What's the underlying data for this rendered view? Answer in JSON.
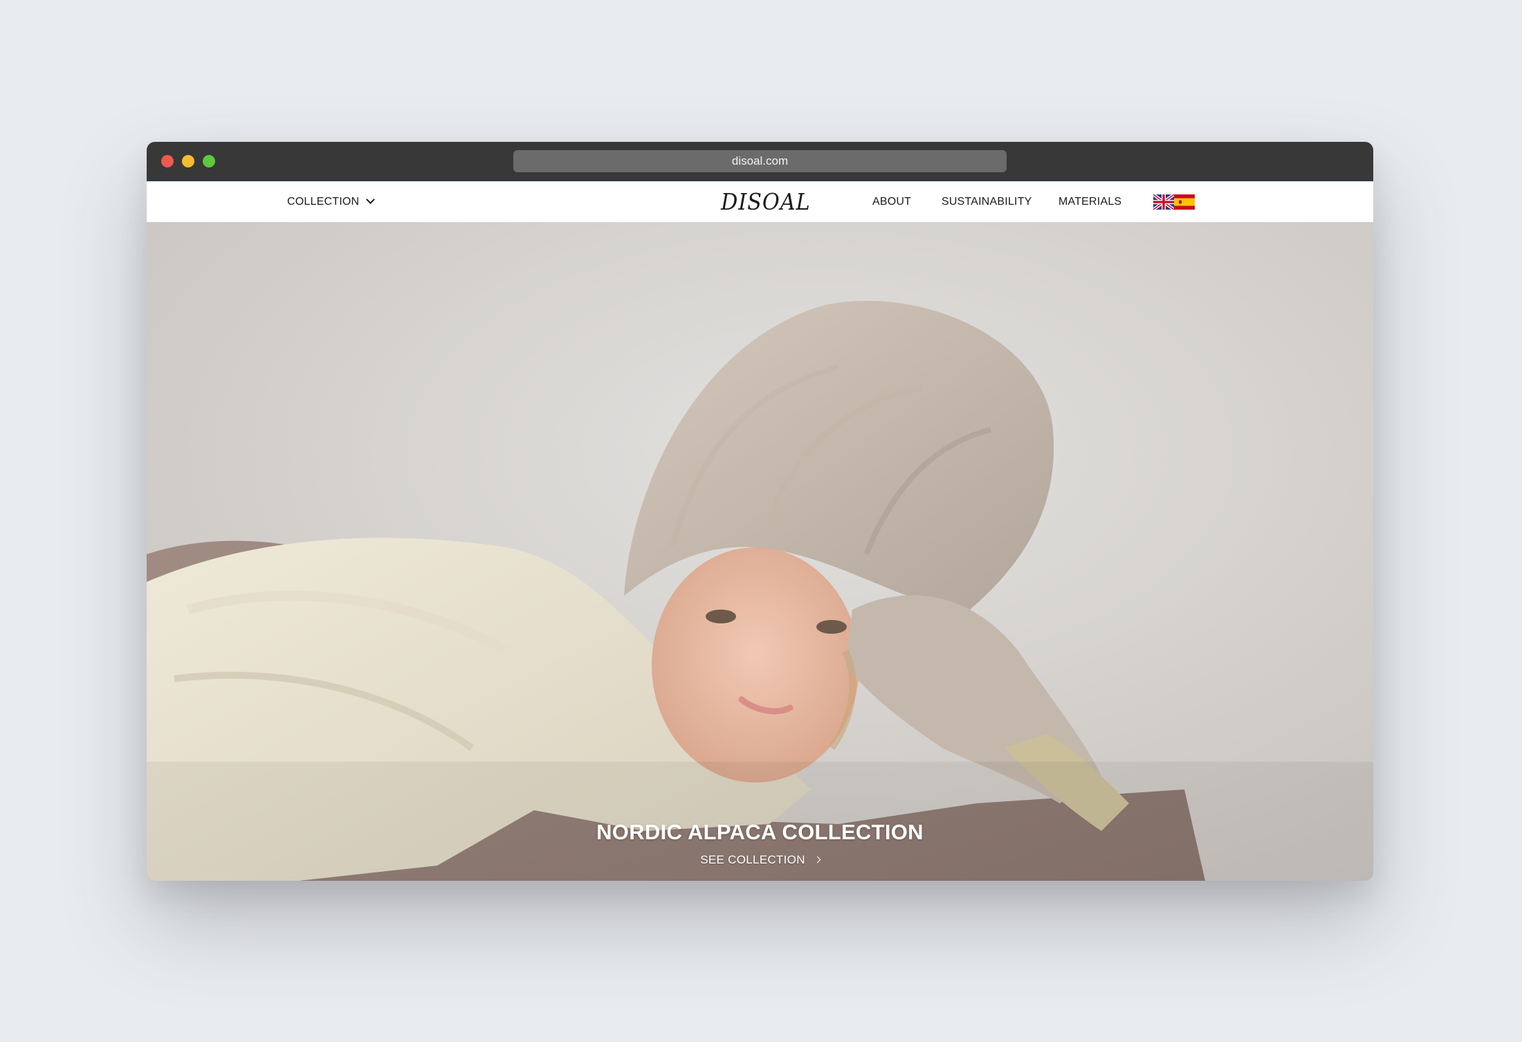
{
  "browser": {
    "url": "disoal.com"
  },
  "nav": {
    "collection_label": "COLLECTION",
    "logo": "DISOAL",
    "about_label": "ABOUT",
    "sustainability_label": "SUSTAINABILITY",
    "materials_label": "MATERIALS",
    "languages": [
      "uk-flag-icon",
      "spain-flag-icon"
    ]
  },
  "hero": {
    "title": "NORDIC ALPACA COLLECTION",
    "cta_label": "SEE COLLECTION"
  },
  "colors": {
    "background": "#e9ecef",
    "titlebar": "#383838",
    "hero_text": "#ffffff"
  }
}
